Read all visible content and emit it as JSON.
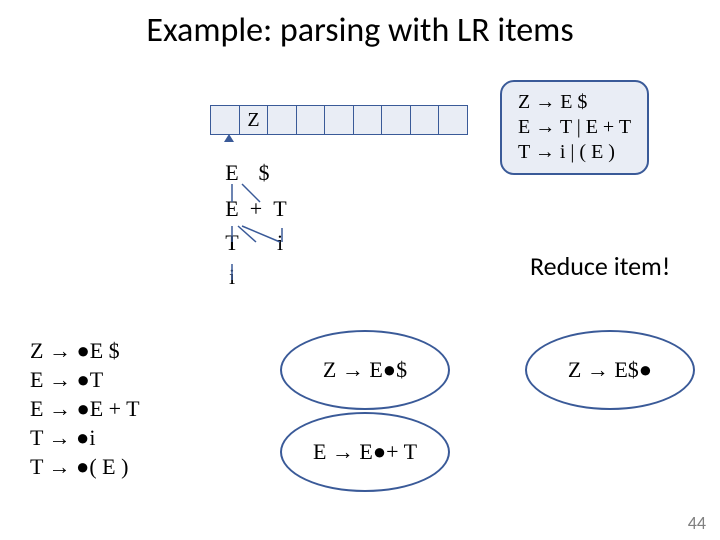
{
  "title": "Example: parsing with LR items",
  "stack": {
    "cells": [
      "",
      "Z",
      "",
      "",
      "",
      "",
      "",
      "",
      ""
    ]
  },
  "grammar": {
    "line1": "Z → E $",
    "line2": "E → T | E + T",
    "line3": "T → i | ( E )"
  },
  "tree": {
    "n_E1": "E",
    "n_dollar": "$",
    "n_E2": "E",
    "n_plus": "+",
    "n_T1": "T",
    "n_T2": "T",
    "n_i1": "i",
    "n_i2": "i"
  },
  "reduce_label": "Reduce item!",
  "items_left": {
    "l1": "Z → ●E $",
    "l2": "E → ●T",
    "l3": "E → ●E + T",
    "l4": "T → ●i",
    "l5": "T → ●( E )"
  },
  "ellipse_items": {
    "e1": "Z → E●$",
    "e2": "Z → E$●",
    "e3": "E → E●+ T"
  },
  "slide_number": "44"
}
